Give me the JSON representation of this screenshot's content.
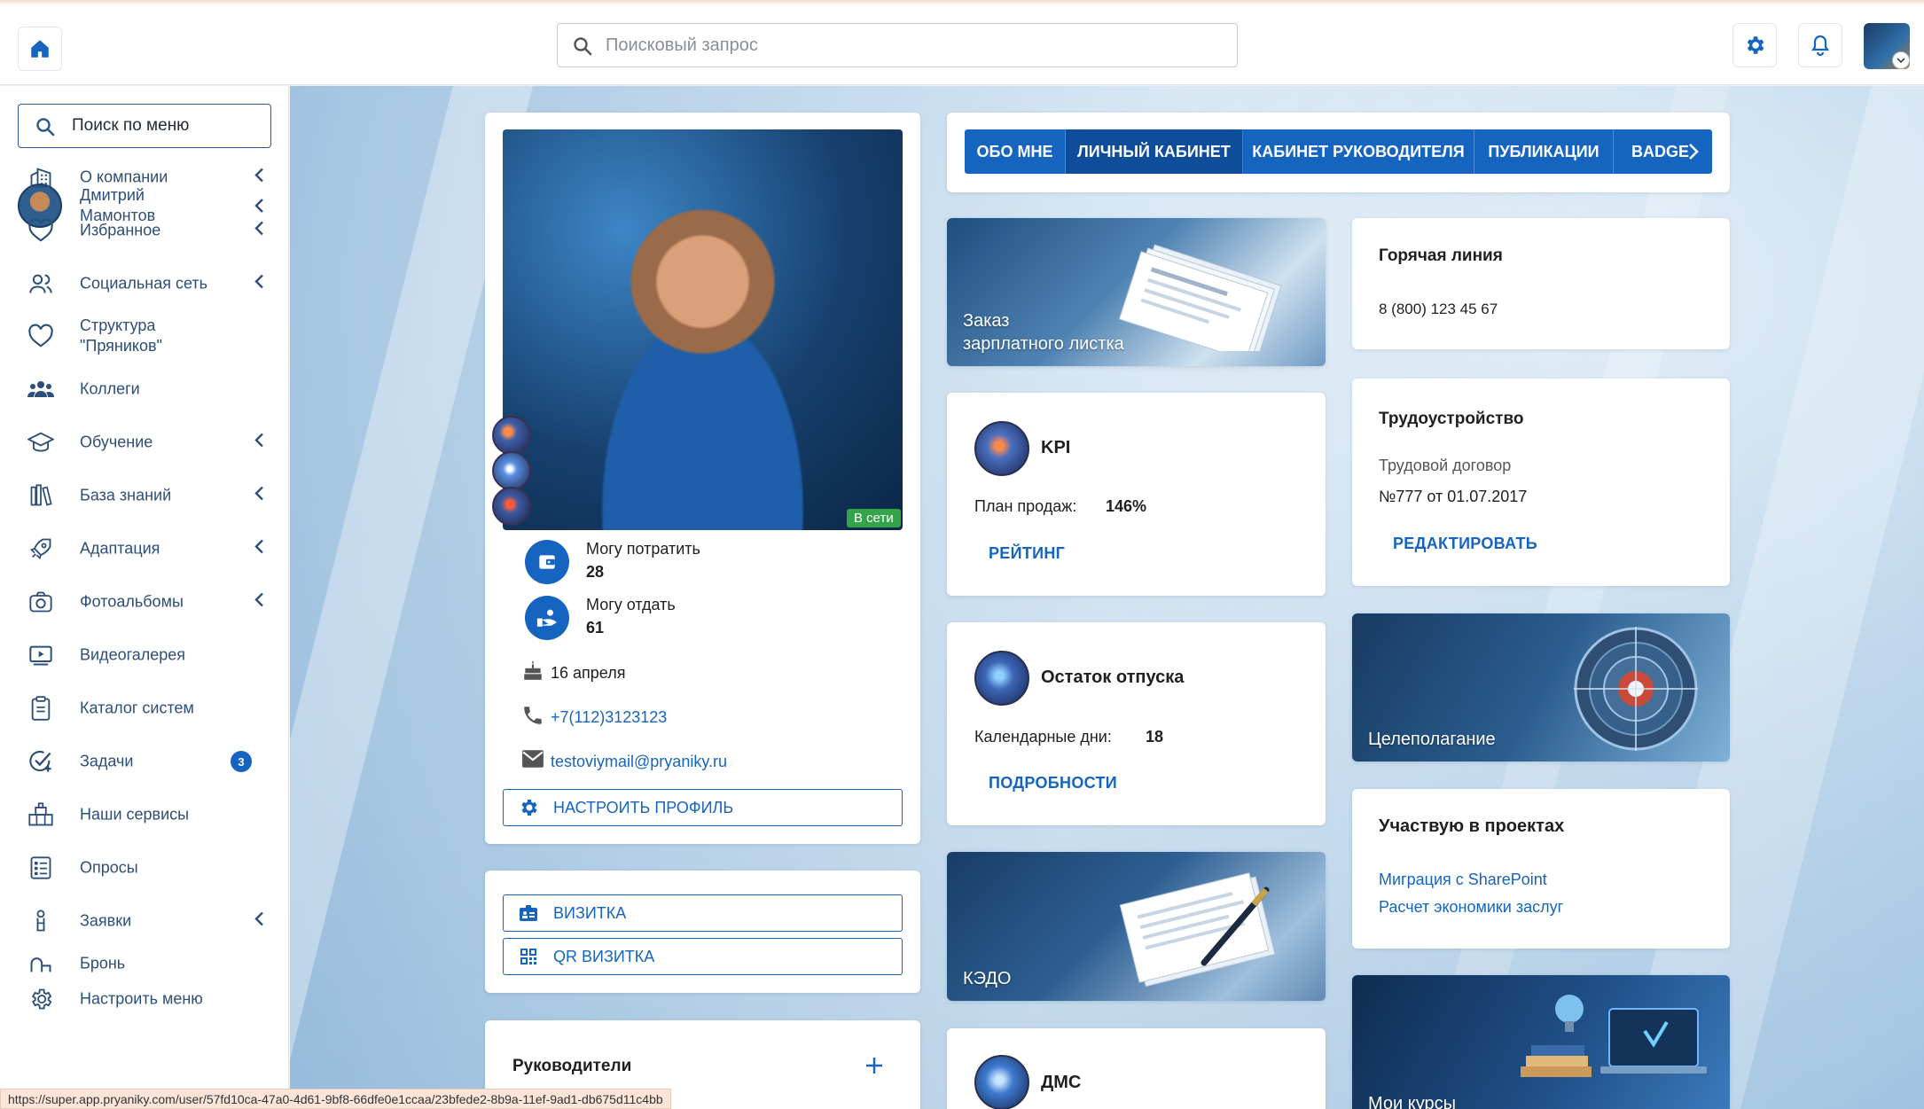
{
  "header": {
    "search_placeholder": "Поисковый запрос"
  },
  "sidebar": {
    "search_label": "Поиск по меню",
    "user_name": "Дмитрий\nМамонтов",
    "items": [
      {
        "label": "О компании",
        "icon": "building-icon",
        "has_chevron": true
      },
      {
        "label": "Избранное",
        "icon": "heart-icon",
        "has_chevron": true
      },
      {
        "label": "Социальная сеть",
        "icon": "users-icon",
        "has_chevron": true
      },
      {
        "label": "Структура\n\"Пряников\"",
        "icon": "heart-icon",
        "has_chevron": false
      },
      {
        "label": "Коллеги",
        "icon": "group-icon",
        "has_chevron": false
      },
      {
        "label": "Обучение",
        "icon": "graduation-cap-icon",
        "has_chevron": true
      },
      {
        "label": "База знаний",
        "icon": "books-icon",
        "has_chevron": true
      },
      {
        "label": "Адаптация",
        "icon": "rocket-icon",
        "has_chevron": true
      },
      {
        "label": "Фотоальбомы",
        "icon": "camera-icon",
        "has_chevron": true
      },
      {
        "label": "Видеогалерея",
        "icon": "video-icon",
        "has_chevron": false
      },
      {
        "label": "Каталог систем",
        "icon": "clipboard-icon",
        "has_chevron": false
      },
      {
        "label": "Задачи",
        "icon": "task-check-icon",
        "has_chevron": false,
        "count": "3"
      },
      {
        "label": "Наши сервисы",
        "icon": "services-icon",
        "has_chevron": false
      },
      {
        "label": "Опросы",
        "icon": "survey-icon",
        "has_chevron": false
      },
      {
        "label": "Заявки",
        "icon": "request-icon",
        "has_chevron": true
      },
      {
        "label": "Бронь",
        "icon": "booking-icon",
        "has_chevron": false
      },
      {
        "label": "Настроить меню",
        "icon": "gear-icon",
        "has_chevron": false
      }
    ]
  },
  "profile": {
    "online": "В сети",
    "spend_label": "Могу потратить",
    "spend_value": "28",
    "give_label": "Могу отдать",
    "give_value": "61",
    "birthday": "16 апреля",
    "phone": "+7(112)3123123",
    "email": "testoviymail@pryaniky.ru",
    "settings_button": "Настроить профиль",
    "card_button": "Визитка",
    "qr_button": "QR визитка",
    "managers_title": "Руководители"
  },
  "tabs": [
    {
      "label": "ОБО МНЕ",
      "active": false
    },
    {
      "label": "ЛИЧНЫЙ КАБИНЕТ",
      "active": true
    },
    {
      "label": "КАБИНЕТ РУКОВОДИТЕЛЯ",
      "active": false
    },
    {
      "label": "ПУБЛИКАЦИИ",
      "active": false
    },
    {
      "label": "BADGE",
      "active": false
    }
  ],
  "widgets": {
    "payslip": "Заказ\nзарплатного листка",
    "kpi_title": "KPI",
    "kpi_label": "План продаж:",
    "kpi_value": "146%",
    "kpi_link": "РЕЙТИНГ",
    "vacation_title": "Остаток отпуска",
    "vacation_label": "Календарные дни:",
    "vacation_value": "18",
    "vacation_link": "ПОДРОБНОСТИ",
    "kedo": "КЭДО",
    "dms_title": "ДМС",
    "hotline_title": "Горячая линия",
    "hotline_phone": "8 (800) 123 45 67",
    "employment_title": "Трудоустройство",
    "employment_line1": "Трудовой договор",
    "employment_line2": "№777 от 01.07.2017",
    "employment_link": "РЕДАКТИРОВАТЬ",
    "goals": "Целеполагание",
    "projects_title": "Участвую в проектах",
    "project_1": "Миграция с SharePoint",
    "project_2": "Расчет экономики заслуг",
    "courses": "Мои курсы"
  },
  "statusbar": "https://super.app.pryaniky.com/user/57fd10ca-47a0-4d61-9bf8-66dfe0e1ccaa/23bfede2-8b9a-11ef-9ad1-db675d11c4bb",
  "colors": {
    "accent": "#1565c0",
    "online": "#35a34a"
  }
}
